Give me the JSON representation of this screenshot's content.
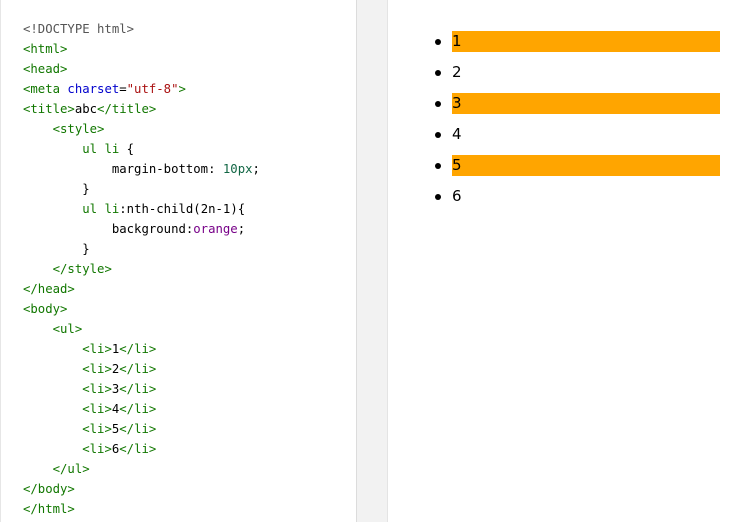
{
  "code_editor": {
    "lines": [
      [
        {
          "c": "t-gray",
          "t": "<!DOCTYPE html>"
        }
      ],
      [
        {
          "c": "t-green",
          "t": "<html>"
        }
      ],
      [
        {
          "c": "t-green",
          "t": "<head>"
        }
      ],
      [
        {
          "c": "t-green",
          "t": "<meta "
        },
        {
          "c": "t-blue",
          "t": "charset"
        },
        {
          "c": "t-plain",
          "t": "="
        },
        {
          "c": "t-red",
          "t": "\"utf-8\""
        },
        {
          "c": "t-green",
          "t": ">"
        }
      ],
      [
        {
          "c": "t-green",
          "t": "<title>"
        },
        {
          "c": "t-plain",
          "t": "abc"
        },
        {
          "c": "t-green",
          "t": "</title>"
        }
      ],
      [
        {
          "c": "t-plain",
          "t": "    "
        },
        {
          "c": "t-green",
          "t": "<style>"
        }
      ],
      [
        {
          "c": "t-plain",
          "t": "        "
        },
        {
          "c": "t-green",
          "t": "ul li "
        },
        {
          "c": "t-plain",
          "t": "{"
        }
      ],
      [
        {
          "c": "t-plain",
          "t": "            margin-bottom: "
        },
        {
          "c": "t-num",
          "t": "10px"
        },
        {
          "c": "t-plain",
          "t": ";"
        }
      ],
      [
        {
          "c": "t-plain",
          "t": "        }"
        }
      ],
      [
        {
          "c": "t-plain",
          "t": "        "
        },
        {
          "c": "t-green",
          "t": "ul li"
        },
        {
          "c": "t-plain",
          "t": ":nth-child(2n-1){"
        }
      ],
      [
        {
          "c": "t-plain",
          "t": "            background:"
        },
        {
          "c": "t-purple",
          "t": "orange"
        },
        {
          "c": "t-plain",
          "t": ";"
        }
      ],
      [
        {
          "c": "t-plain",
          "t": "        }"
        }
      ],
      [
        {
          "c": "t-plain",
          "t": "    "
        },
        {
          "c": "t-green",
          "t": "</style>"
        }
      ],
      [
        {
          "c": "t-green",
          "t": "</head>"
        }
      ],
      [
        {
          "c": "t-green",
          "t": "<body>"
        }
      ],
      [
        {
          "c": "t-plain",
          "t": "    "
        },
        {
          "c": "t-green",
          "t": "<ul>"
        }
      ],
      [
        {
          "c": "t-plain",
          "t": "        "
        },
        {
          "c": "t-green",
          "t": "<li>"
        },
        {
          "c": "t-plain",
          "t": "1"
        },
        {
          "c": "t-green",
          "t": "</li>"
        }
      ],
      [
        {
          "c": "t-plain",
          "t": "        "
        },
        {
          "c": "t-green",
          "t": "<li>"
        },
        {
          "c": "t-plain",
          "t": "2"
        },
        {
          "c": "t-green",
          "t": "</li>"
        }
      ],
      [
        {
          "c": "t-plain",
          "t": "        "
        },
        {
          "c": "t-green",
          "t": "<li>"
        },
        {
          "c": "t-plain",
          "t": "3"
        },
        {
          "c": "t-green",
          "t": "</li>"
        }
      ],
      [
        {
          "c": "t-plain",
          "t": "        "
        },
        {
          "c": "t-green",
          "t": "<li>"
        },
        {
          "c": "t-plain",
          "t": "4"
        },
        {
          "c": "t-green",
          "t": "</li>"
        }
      ],
      [
        {
          "c": "t-plain",
          "t": "        "
        },
        {
          "c": "t-green",
          "t": "<li>"
        },
        {
          "c": "t-plain",
          "t": "5"
        },
        {
          "c": "t-green",
          "t": "</li>"
        }
      ],
      [
        {
          "c": "t-plain",
          "t": "        "
        },
        {
          "c": "t-green",
          "t": "<li>"
        },
        {
          "c": "t-plain",
          "t": "6"
        },
        {
          "c": "t-green",
          "t": "</li>"
        }
      ],
      [
        {
          "c": "t-plain",
          "t": "    "
        },
        {
          "c": "t-green",
          "t": "</ul>"
        }
      ],
      [
        {
          "c": "t-green",
          "t": "</body>"
        }
      ],
      [
        {
          "c": "t-green",
          "t": "</html>"
        }
      ]
    ]
  },
  "result": {
    "items": [
      {
        "label": "1",
        "highlighted": true
      },
      {
        "label": "2",
        "highlighted": false
      },
      {
        "label": "3",
        "highlighted": true
      },
      {
        "label": "4",
        "highlighted": false
      },
      {
        "label": "5",
        "highlighted": true
      },
      {
        "label": "6",
        "highlighted": false
      }
    ],
    "highlight_color": "#ffa500"
  },
  "colors": {
    "tag": "#117700",
    "attribute": "#0000cc",
    "string": "#aa1111",
    "keyword_value": "#770088",
    "number": "#116644",
    "doctype": "#555555"
  }
}
